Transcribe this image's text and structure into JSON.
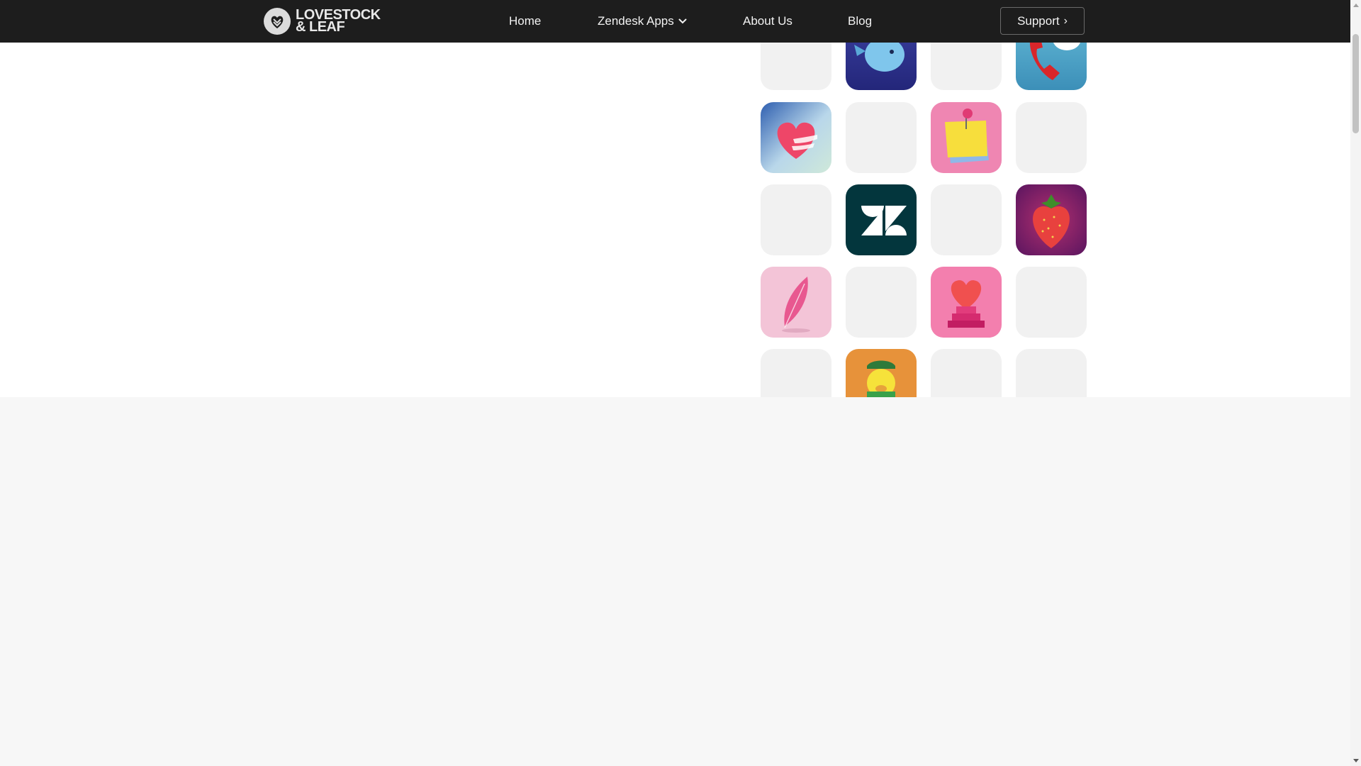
{
  "nav": {
    "logo_line1": "LOVESTOCK",
    "logo_line2": "& LEAF",
    "home": "Home",
    "zendesk_apps": "Zendesk Apps",
    "about_us": "About Us",
    "blog": "Blog",
    "support": "Support",
    "support_chevron": "›"
  },
  "icons": [
    "whale-app-icon",
    "phone-chat-app-icon",
    "heart-hands-app-icon",
    "sticky-note-app-icon",
    "zendesk-logo-icon",
    "strawberry-app-icon",
    "feather-app-icon",
    "heart-stairs-app-icon",
    "chick-mascot-app-icon"
  ],
  "colors": {
    "nav_bg": "#1d1d1d",
    "page_bg": "#f7f7f7",
    "tile_placeholder": "#f1f1f1",
    "zendesk_green": "#03363d"
  }
}
